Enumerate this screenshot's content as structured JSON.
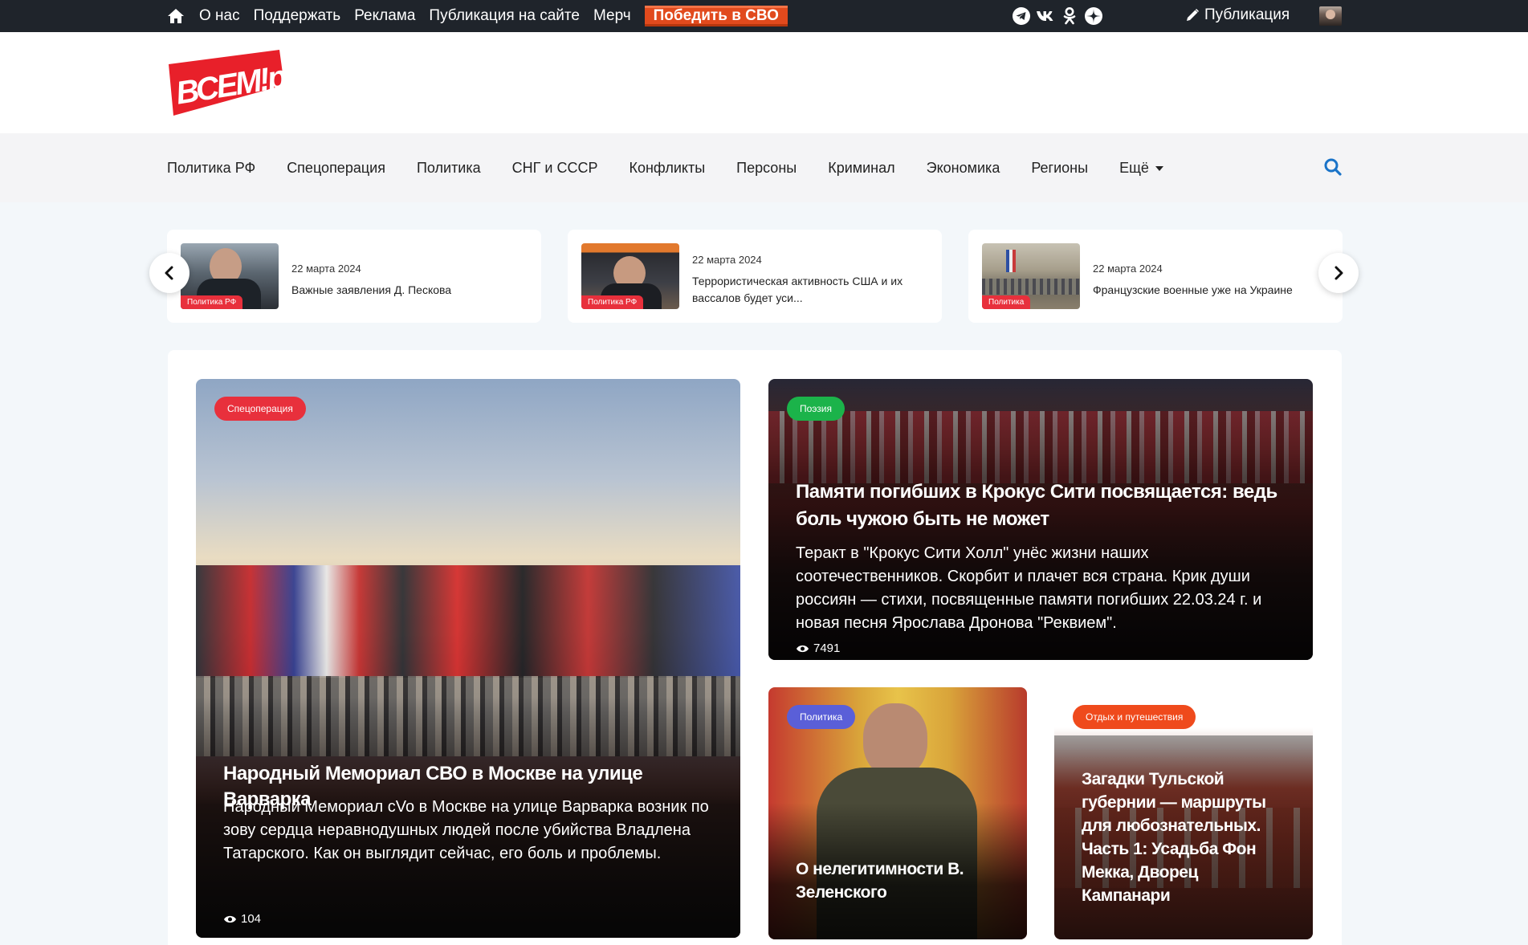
{
  "topbar": {
    "links": [
      "О нас",
      "Поддержать",
      "Реклама",
      "Публикация на сайте",
      "Мерч"
    ],
    "accent_link": "Победить в СВО",
    "social_icons": [
      "telegram-icon",
      "vk-icon",
      "odnoklassniki-icon",
      "zen-icon"
    ],
    "publish_label": "Публикация",
    "colors": {
      "background": "#1f242b",
      "accent": "#e14a1d"
    }
  },
  "logo": {
    "text": "ВСЕМ!ру",
    "color": "#e8202a"
  },
  "nav": {
    "items": [
      "Политика РФ",
      "Спецоперация",
      "Политика",
      "СНГ и СССР",
      "Конфликты",
      "Персоны",
      "Криминал",
      "Экономика",
      "Регионы"
    ],
    "more_label": "Ещё"
  },
  "ticker": [
    {
      "date": "22 марта 2024",
      "title": "Важные заявления Д. Пескова",
      "badge": "Политика РФ"
    },
    {
      "date": "22 марта 2024",
      "title": "Террористическая активность США и их вассалов будет уси...",
      "badge": "Политика РФ"
    },
    {
      "date": "22 марта 2024",
      "title": "Французские военные уже на Украине",
      "badge": "Политика"
    }
  ],
  "featured": {
    "category": "Спецоперация",
    "title": "Народный Мемориал СВО в Москве на улице Варварка",
    "excerpt": "Народный Мемориал cVo в Москве на улице Варварка возник по зову сердца неравнодушных людей после убийства Владлена Татарского. Как он выглядит сейчас, его боль и проблемы.",
    "views": "104"
  },
  "second": {
    "category": "Поэзия",
    "title": "Памяти погибших в Крокус Сити посвящается: ведь боль чужою быть не может",
    "excerpt": "Теракт в \"Крокус Сити Холл\" унёс жизни наших соотечественников. Скорбит и плачет вся страна. Крик души россиян — стихи, посвященные памяти погибших 22.03.24 г. и новая песня Ярослава Дронова \"Реквием\".",
    "views": "7491"
  },
  "third": {
    "category": "Политика",
    "title": "О нелегитимности В. Зеленского"
  },
  "fourth": {
    "category": "Отдых и путешествия",
    "title": "Загадки Тульской губернии — маршруты для любознательных. Часть 1: Усадьба Фон Мекка, Дворец Кампанари"
  },
  "category_colors": {
    "Спецоперация": "#e8303c",
    "Поэзия": "#1bb34a",
    "Политика": "#5a5fd8",
    "Отдых и путешествия": "#ef4a1c"
  }
}
